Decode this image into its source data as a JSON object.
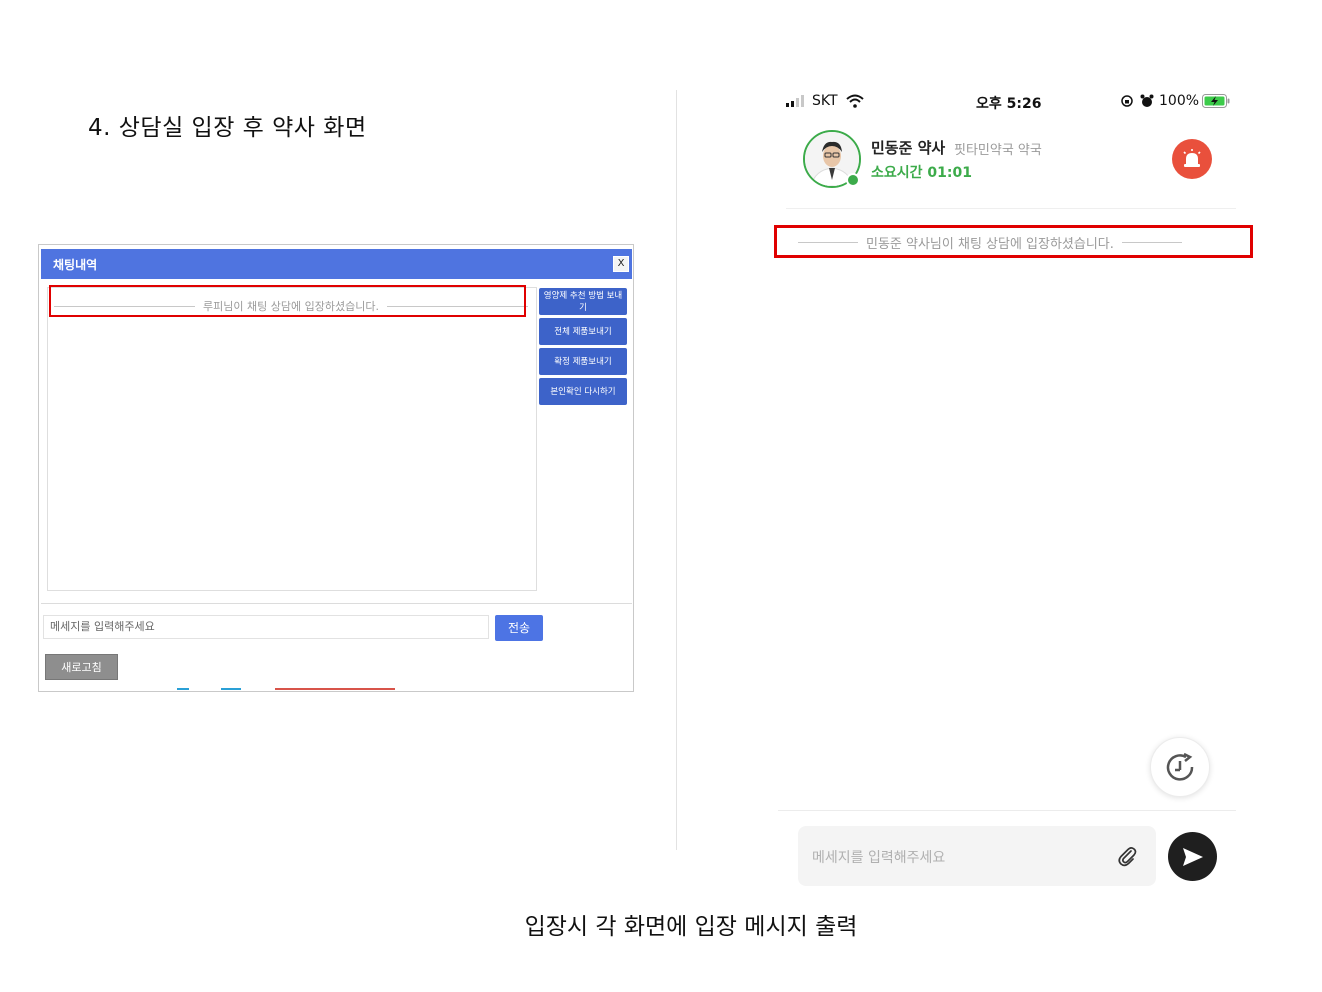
{
  "section_title": "4. 상담실 입장 후 약사 화면",
  "pc_chat": {
    "header_title": "채팅내역",
    "close_label": "X",
    "enter_notice": "루피님이 채팅 상담에 입장하셨습니다.",
    "side_buttons": [
      {
        "label": "영양제 추천 방법 보내기"
      },
      {
        "label": "전체 제품보내기"
      },
      {
        "label": "확정 제품보내기"
      },
      {
        "label": "본인확인 다시하기"
      }
    ],
    "input_placeholder": "메세지를 입력해주세요",
    "send_label": "전송",
    "refresh_label": "새로고침"
  },
  "mobile": {
    "status_bar": {
      "carrier": "SKT",
      "time": "오후 5:26",
      "battery": "100%"
    },
    "header": {
      "pharmacist_name": "민동준 약사",
      "pharmacy_name": "핏타민약국 약국",
      "elapsed": "소요시간 01:01"
    },
    "enter_notice": "민동준 약사님이 채팅 상담에 입장하셨습니다.",
    "input_placeholder": "메세지를 입력해주세요"
  },
  "caption": "입장시 각 화면에 입장 메시지 출력",
  "colors": {
    "pc_header": "#4f74e0",
    "pc_button": "#3d63c9",
    "highlight": "#e00000",
    "online_green": "#3cab4a",
    "alarm_red": "#e9503c"
  },
  "icons": [
    "signal-icon",
    "wifi-icon",
    "rotation-lock-icon",
    "alarm-clock-icon",
    "battery-icon",
    "siren-icon",
    "scroll-history-icon",
    "paperclip-icon",
    "send-icon"
  ]
}
